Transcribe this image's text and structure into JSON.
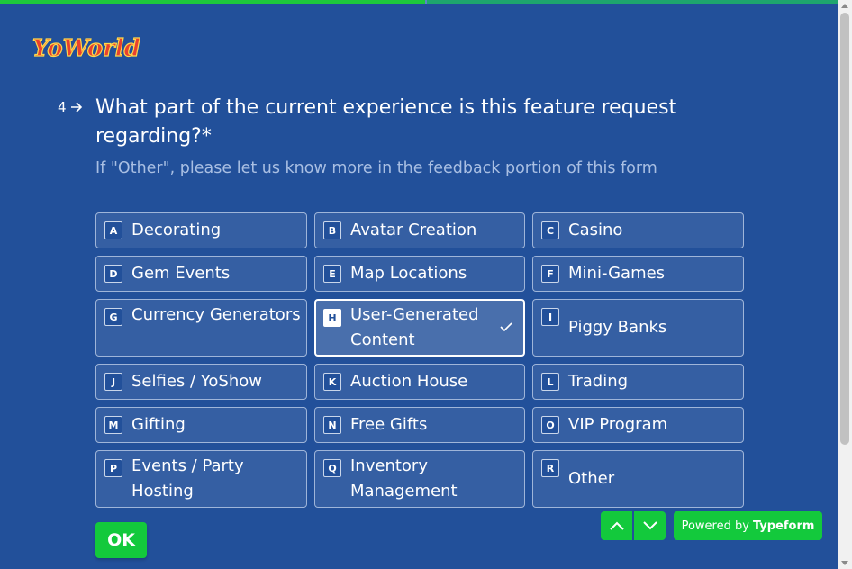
{
  "logo_text": "YoWorld",
  "progress": 0.5,
  "question": {
    "number": "4",
    "title": "What part of the current experience is this feature request regarding?*",
    "subtitle": "If \"Other\", please let us know more in the feedback portion of this form"
  },
  "options": [
    {
      "key": "A",
      "label": "Decorating"
    },
    {
      "key": "B",
      "label": "Avatar Creation"
    },
    {
      "key": "C",
      "label": "Casino"
    },
    {
      "key": "D",
      "label": "Gem Events"
    },
    {
      "key": "E",
      "label": "Map Locations"
    },
    {
      "key": "F",
      "label": "Mini-Games"
    },
    {
      "key": "G",
      "label": "Currency Generators"
    },
    {
      "key": "H",
      "label": "User-Generated Content",
      "selected": true
    },
    {
      "key": "I",
      "label": "Piggy Banks"
    },
    {
      "key": "J",
      "label": "Selfies / YoShow"
    },
    {
      "key": "K",
      "label": "Auction House"
    },
    {
      "key": "L",
      "label": "Trading"
    },
    {
      "key": "M",
      "label": "Gifting"
    },
    {
      "key": "N",
      "label": "Free Gifts"
    },
    {
      "key": "O",
      "label": "VIP Program"
    },
    {
      "key": "P",
      "label": "Events / Party Hosting"
    },
    {
      "key": "Q",
      "label": "Inventory Management"
    },
    {
      "key": "R",
      "label": "Other"
    }
  ],
  "ok_label": "OK",
  "powered_by": {
    "prefix": "Powered by",
    "brand": "Typeform"
  },
  "colors": {
    "background": "#22509a",
    "accent": "#13c93c",
    "subtitle": "#a9bfe3"
  }
}
